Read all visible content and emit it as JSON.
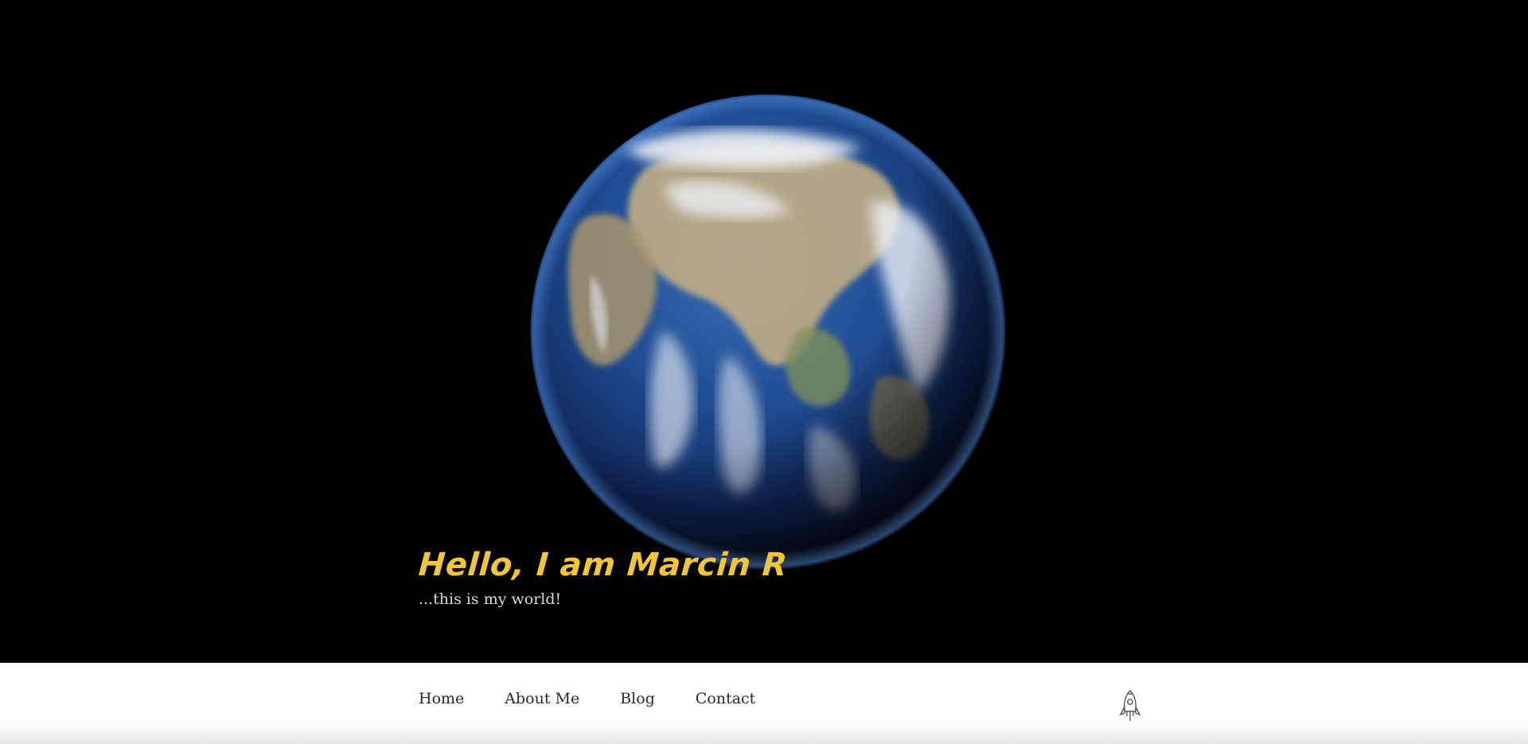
{
  "hero": {
    "title": "Hello, I am Marcin R",
    "subtitle": "...this is my world!",
    "background_color": "#000000",
    "title_color": "#f3c632",
    "image": "earth-globe"
  },
  "nav": {
    "items": [
      {
        "label": "Home"
      },
      {
        "label": "About Me"
      },
      {
        "label": "Blog"
      },
      {
        "label": "Contact"
      }
    ],
    "logo_icon": "rocket-icon"
  }
}
